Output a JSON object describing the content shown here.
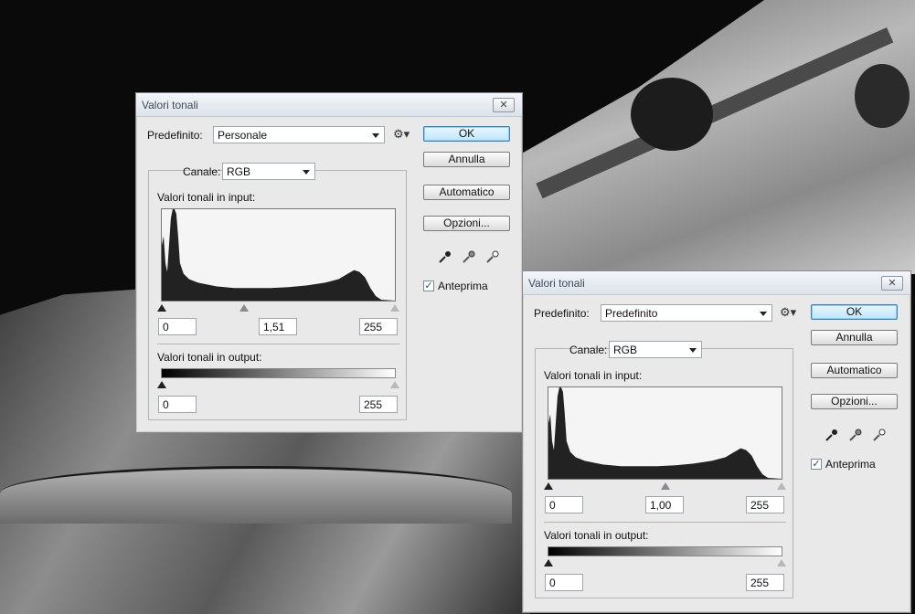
{
  "dialog1": {
    "title": "Valori tonali",
    "preset_label": "Predefinito:",
    "preset_value": "Personale",
    "channel_label": "Canale:",
    "channel_value": "RGB",
    "input_label": "Valori tonali in input:",
    "input_black": "0",
    "input_gamma": "1,51",
    "input_white": "255",
    "output_label": "Valori tonali in output:",
    "output_black": "0",
    "output_white": "255",
    "buttons": {
      "ok": "OK",
      "cancel": "Annulla",
      "auto": "Automatico",
      "options": "Opzioni..."
    },
    "preview_label": "Anteprima",
    "preview_checked": true
  },
  "dialog2": {
    "title": "Valori tonali",
    "preset_label": "Predefinito:",
    "preset_value": "Predefinito",
    "channel_label": "Canale:",
    "channel_value": "RGB",
    "input_label": "Valori tonali in input:",
    "input_black": "0",
    "input_gamma": "1,00",
    "input_white": "255",
    "output_label": "Valori tonali in output:",
    "output_black": "0",
    "output_white": "255",
    "buttons": {
      "ok": "OK",
      "cancel": "Annulla",
      "auto": "Automatico",
      "options": "Opzioni..."
    },
    "preview_label": "Anteprima",
    "preview_checked": true
  },
  "icons": {
    "close": "close-icon",
    "gear": "gear-icon",
    "eyedroppers": [
      "black-eyedropper-icon",
      "gray-eyedropper-icon",
      "white-eyedropper-icon"
    ]
  },
  "colors": {
    "default_button": "#bee6fd",
    "histogram_fill": "#222222"
  }
}
